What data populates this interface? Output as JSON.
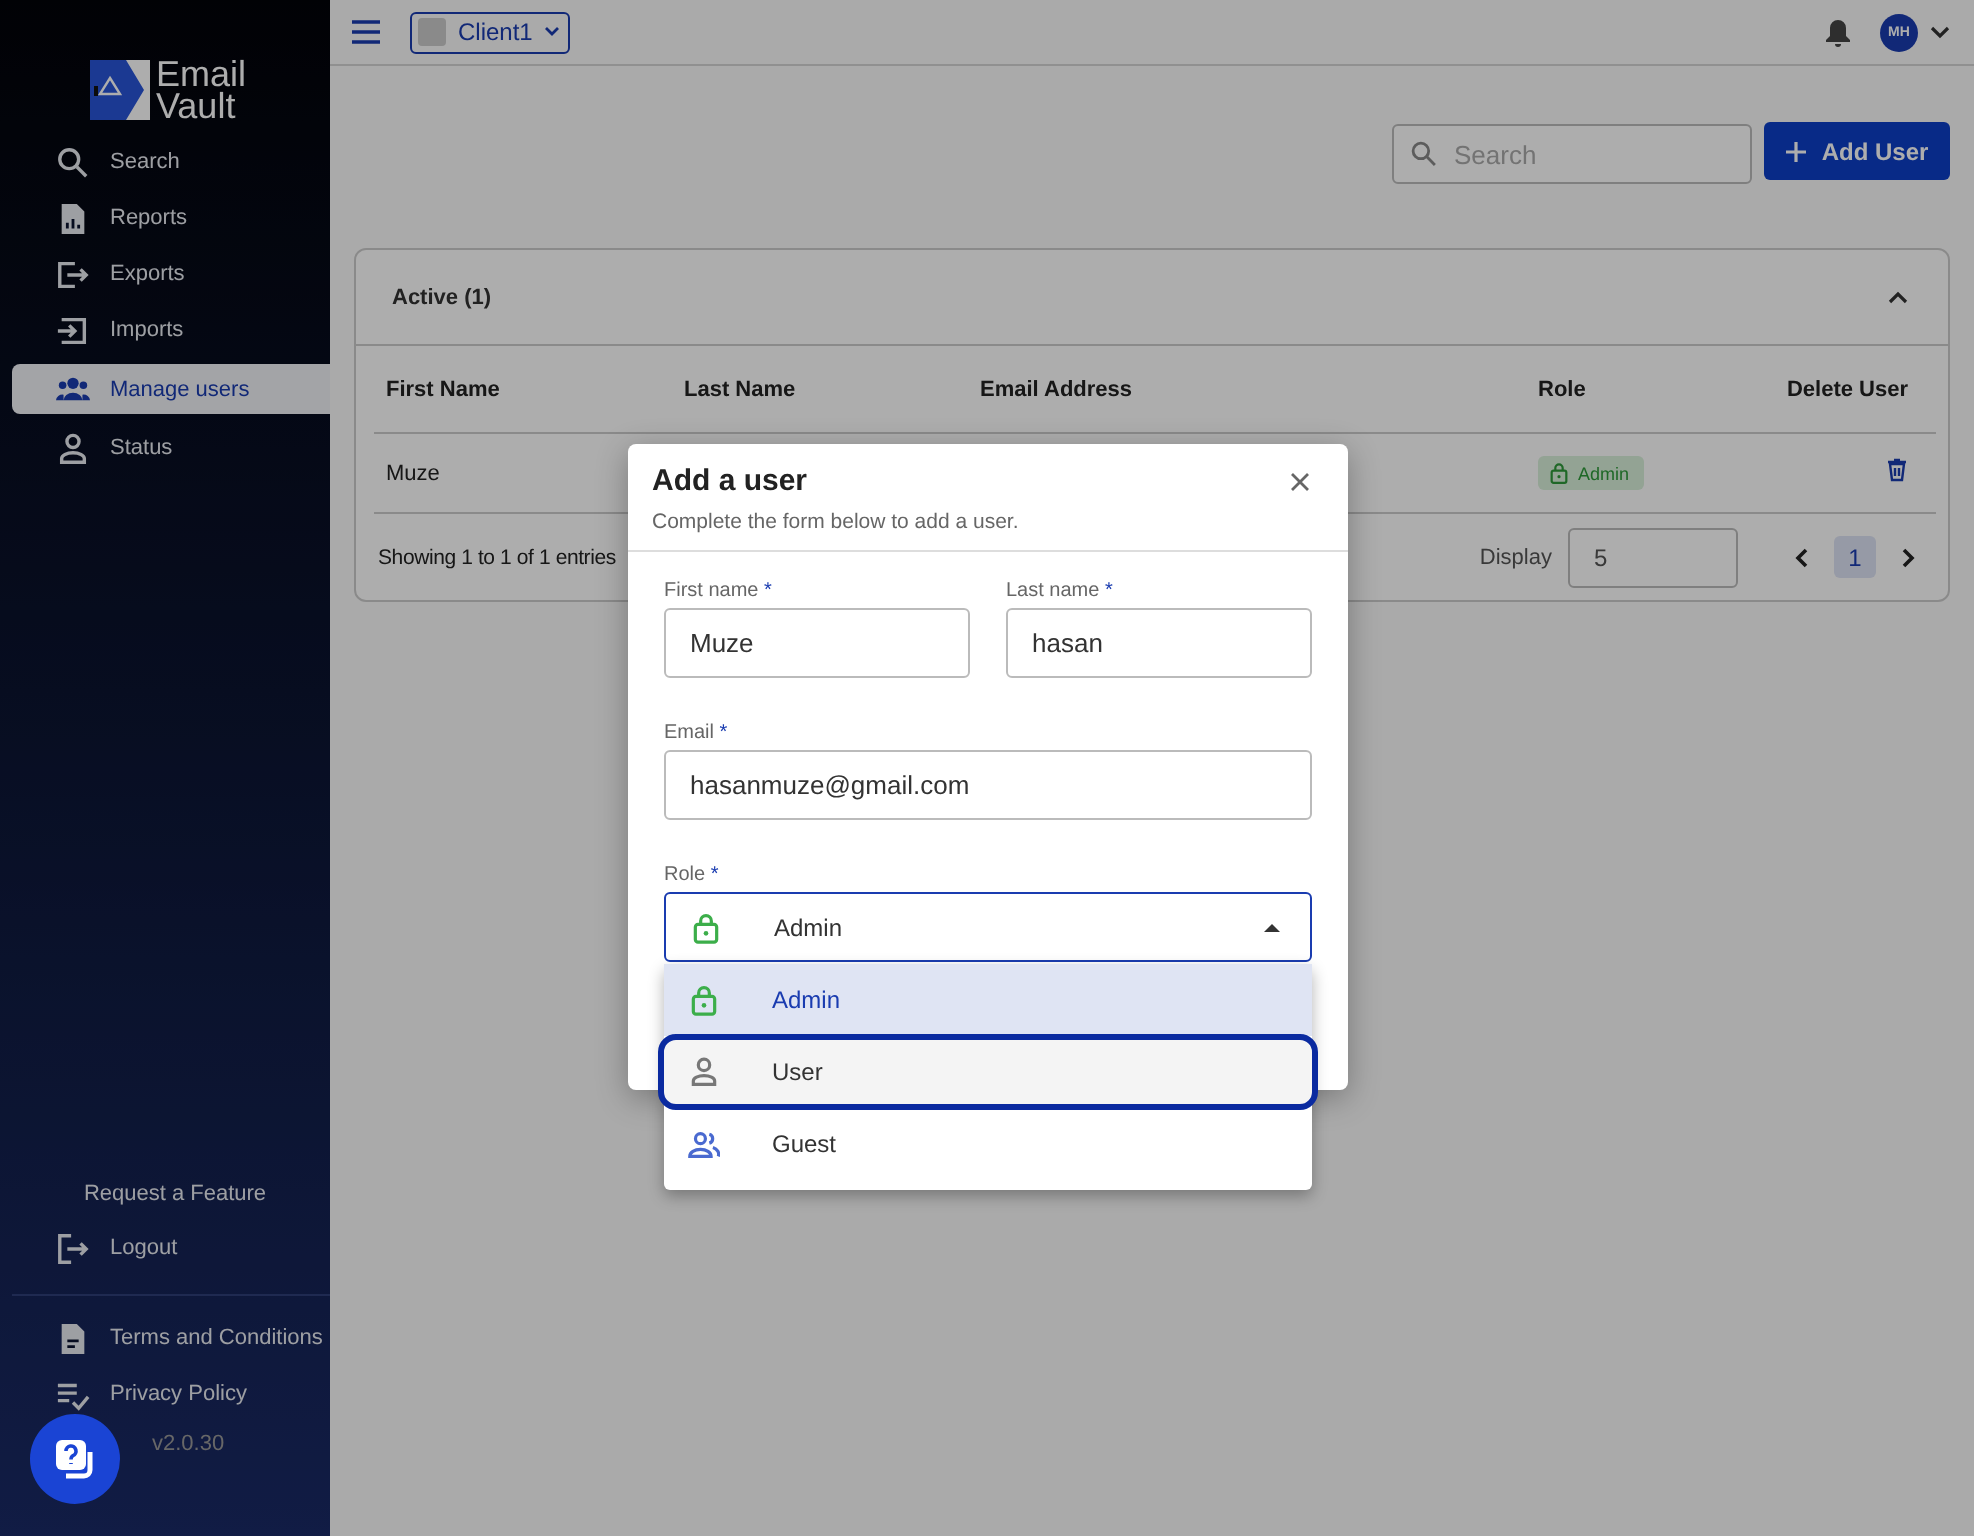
{
  "sidebar": {
    "logo": {
      "line_1": "Email",
      "line_2": "Vault"
    },
    "nav_items": [
      {
        "label": "Search",
        "kind": "search",
        "selected": false
      },
      {
        "label": "Reports",
        "kind": "report",
        "selected": false
      },
      {
        "label": "Exports",
        "kind": "export",
        "selected": false
      },
      {
        "label": "Imports",
        "kind": "import",
        "selected": false
      },
      {
        "label": "Manage users",
        "kind": "users",
        "selected": true
      },
      {
        "label": "Status",
        "kind": "person",
        "selected": false
      }
    ],
    "request_feature": "Request a Feature",
    "logout": "Logout",
    "footer_links": [
      {
        "label": "Terms and Conditions",
        "kind": "document"
      },
      {
        "label": "Privacy Policy",
        "kind": "checklist"
      }
    ],
    "version": "v2.0.30"
  },
  "top_bar": {
    "client": "Client1",
    "avatar_initials": "MH"
  },
  "toolbar": {
    "search": {
      "placeholder": "Search"
    },
    "add_button": "Add User"
  },
  "users_panel": {
    "title": "Active (1)",
    "expanded": true,
    "columns": [
      "First Name",
      "Last Name",
      "Email Address",
      "Role",
      "Delete User"
    ],
    "rows": [
      {
        "first_name": "Muze",
        "role": "Admin"
      }
    ],
    "summary": "Showing 1 to 1 of 1 entries",
    "display_label": "Display",
    "display_value": "5",
    "pages": [
      {
        "label": "1",
        "selected": true
      }
    ]
  },
  "dialog": {
    "title": "Add a user",
    "subtitle": "Complete the form below to add a user.",
    "name_fields": [
      {
        "label": "First name",
        "required_mark": "*",
        "value": "Muze"
      },
      {
        "label": "Last name",
        "required_mark": "*",
        "value": "hasan"
      }
    ],
    "email_field": {
      "label": "Email",
      "required_mark": "*",
      "value": "hasanmuze@gmail.com"
    },
    "role": {
      "label": "Role",
      "required_mark": "*",
      "value": "Admin",
      "expanded": true,
      "options": [
        {
          "label": "Admin",
          "kind": "lock",
          "selected": true,
          "focused": false
        },
        {
          "label": "User",
          "kind": "person",
          "selected": false,
          "focused": true
        },
        {
          "label": "Guest",
          "kind": "people",
          "selected": false,
          "focused": false
        }
      ]
    }
  }
}
